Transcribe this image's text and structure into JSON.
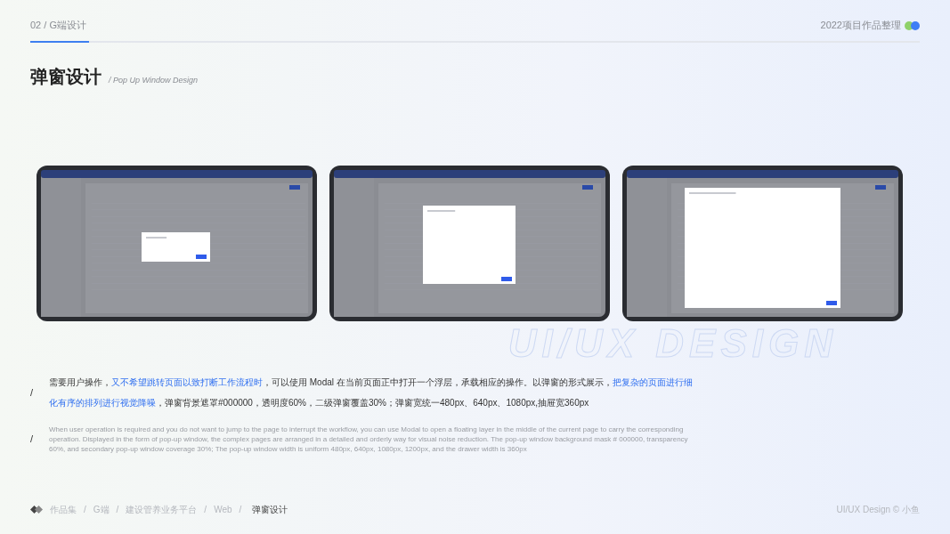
{
  "header": {
    "section": "02 / G端设计",
    "collection": "2022项目作品整理",
    "dots": [
      {
        "color": "#8fd16a"
      },
      {
        "color": "#3f7ef5"
      }
    ]
  },
  "title": {
    "main": "弹窗设计",
    "subtitle": "/ Pop Up Window Design"
  },
  "background_text": "UI/UX DESIGN",
  "description": {
    "marker": "/",
    "segments": [
      {
        "text": "需要用户操作，",
        "highlight": false
      },
      {
        "text": "又不希望跳转页面以致打断工作流程时",
        "highlight": true
      },
      {
        "text": "，可以使用 Modal 在当前页面正中打开一个浮层，承载相应的操作。以弹窗的形式展示，",
        "highlight": false
      },
      {
        "text": "把复杂的页面进行细化有序的排列进行视觉降噪",
        "highlight": true
      },
      {
        "text": "，弹窗背景遮罩#000000，透明度60%，二级弹窗覆盖30%；弹窗宽统一480px、640px、1080px,抽屉宽360px",
        "highlight": false
      }
    ]
  },
  "description_en": {
    "marker": "/",
    "text": "When user operation is required and you do not want to jump to the page to interrupt the workflow, you can use Modal to open a floating layer in the middle of the current page to carry the corresponding operation. Displayed in the form of pop-up window, the complex pages are arranged in a detailed and orderly way for visual noise reduction. The pop-up window background mask # 000000, transparency 60%, and secondary pop-up window coverage 30%; The pop-up window width is uniform 480px, 640px, 1080px, 1200px, and the drawer width is 360px"
  },
  "breadcrumb": [
    {
      "label": "作品集",
      "selected": false
    },
    {
      "label": "G端",
      "selected": false
    },
    {
      "label": "建设管养业务平台",
      "selected": false
    },
    {
      "label": "Web",
      "selected": false
    },
    {
      "label": "弹窗设计",
      "selected": true
    }
  ],
  "breadcrumb_separator": "/",
  "credit": "UI/UX Design © 小鱼"
}
